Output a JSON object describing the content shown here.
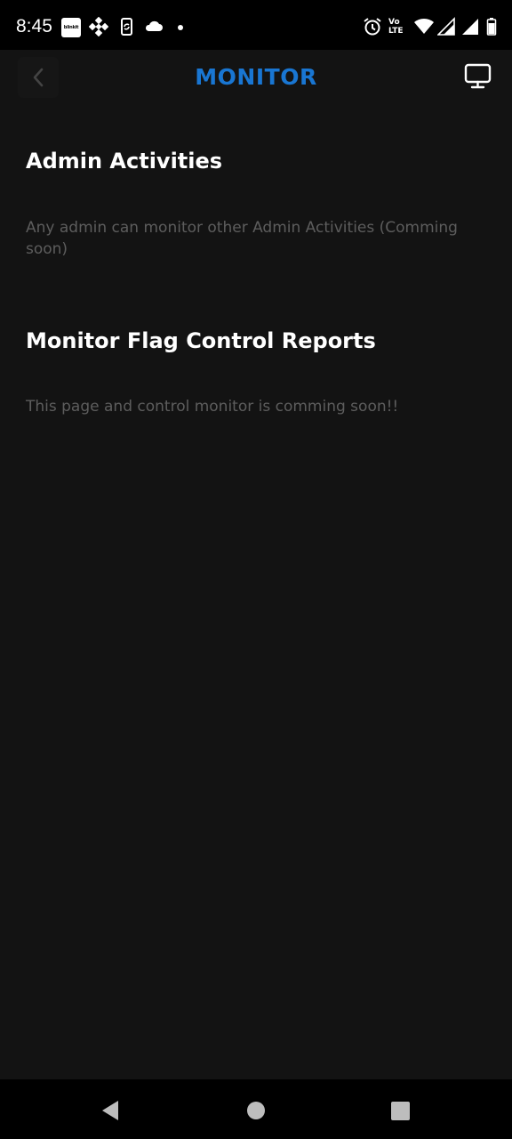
{
  "status_bar": {
    "time": "8:45",
    "notification_icons": [
      "blinkit-icon",
      "binance-icon",
      "phone-sync-icon",
      "cloud-icon",
      "dot-icon"
    ],
    "system_icons": [
      "alarm-icon",
      "volte-icon",
      "wifi-icon",
      "signal-icon",
      "signal-icon",
      "battery-icon"
    ],
    "blinkit_label": "blinkit",
    "volte_label_top": "Vo",
    "volte_label_bottom": "LTE"
  },
  "header": {
    "title": "MONITOR",
    "title_color": "#1976d2",
    "back_icon": "chevron-left-icon",
    "right_icon": "monitor-icon"
  },
  "sections": [
    {
      "title": "Admin Activities",
      "description": "Any admin can monitor other Admin Activities (Comming soon)"
    },
    {
      "title": "Monitor Flag Control Reports",
      "description": "This page and control monitor is comming soon!!"
    }
  ],
  "nav_bar": {
    "buttons": [
      "back-triangle-icon",
      "home-circle-icon",
      "recents-square-icon"
    ]
  },
  "colors": {
    "background": "#131313",
    "accent": "#1976d2",
    "muted_text": "#5d5d5d"
  }
}
